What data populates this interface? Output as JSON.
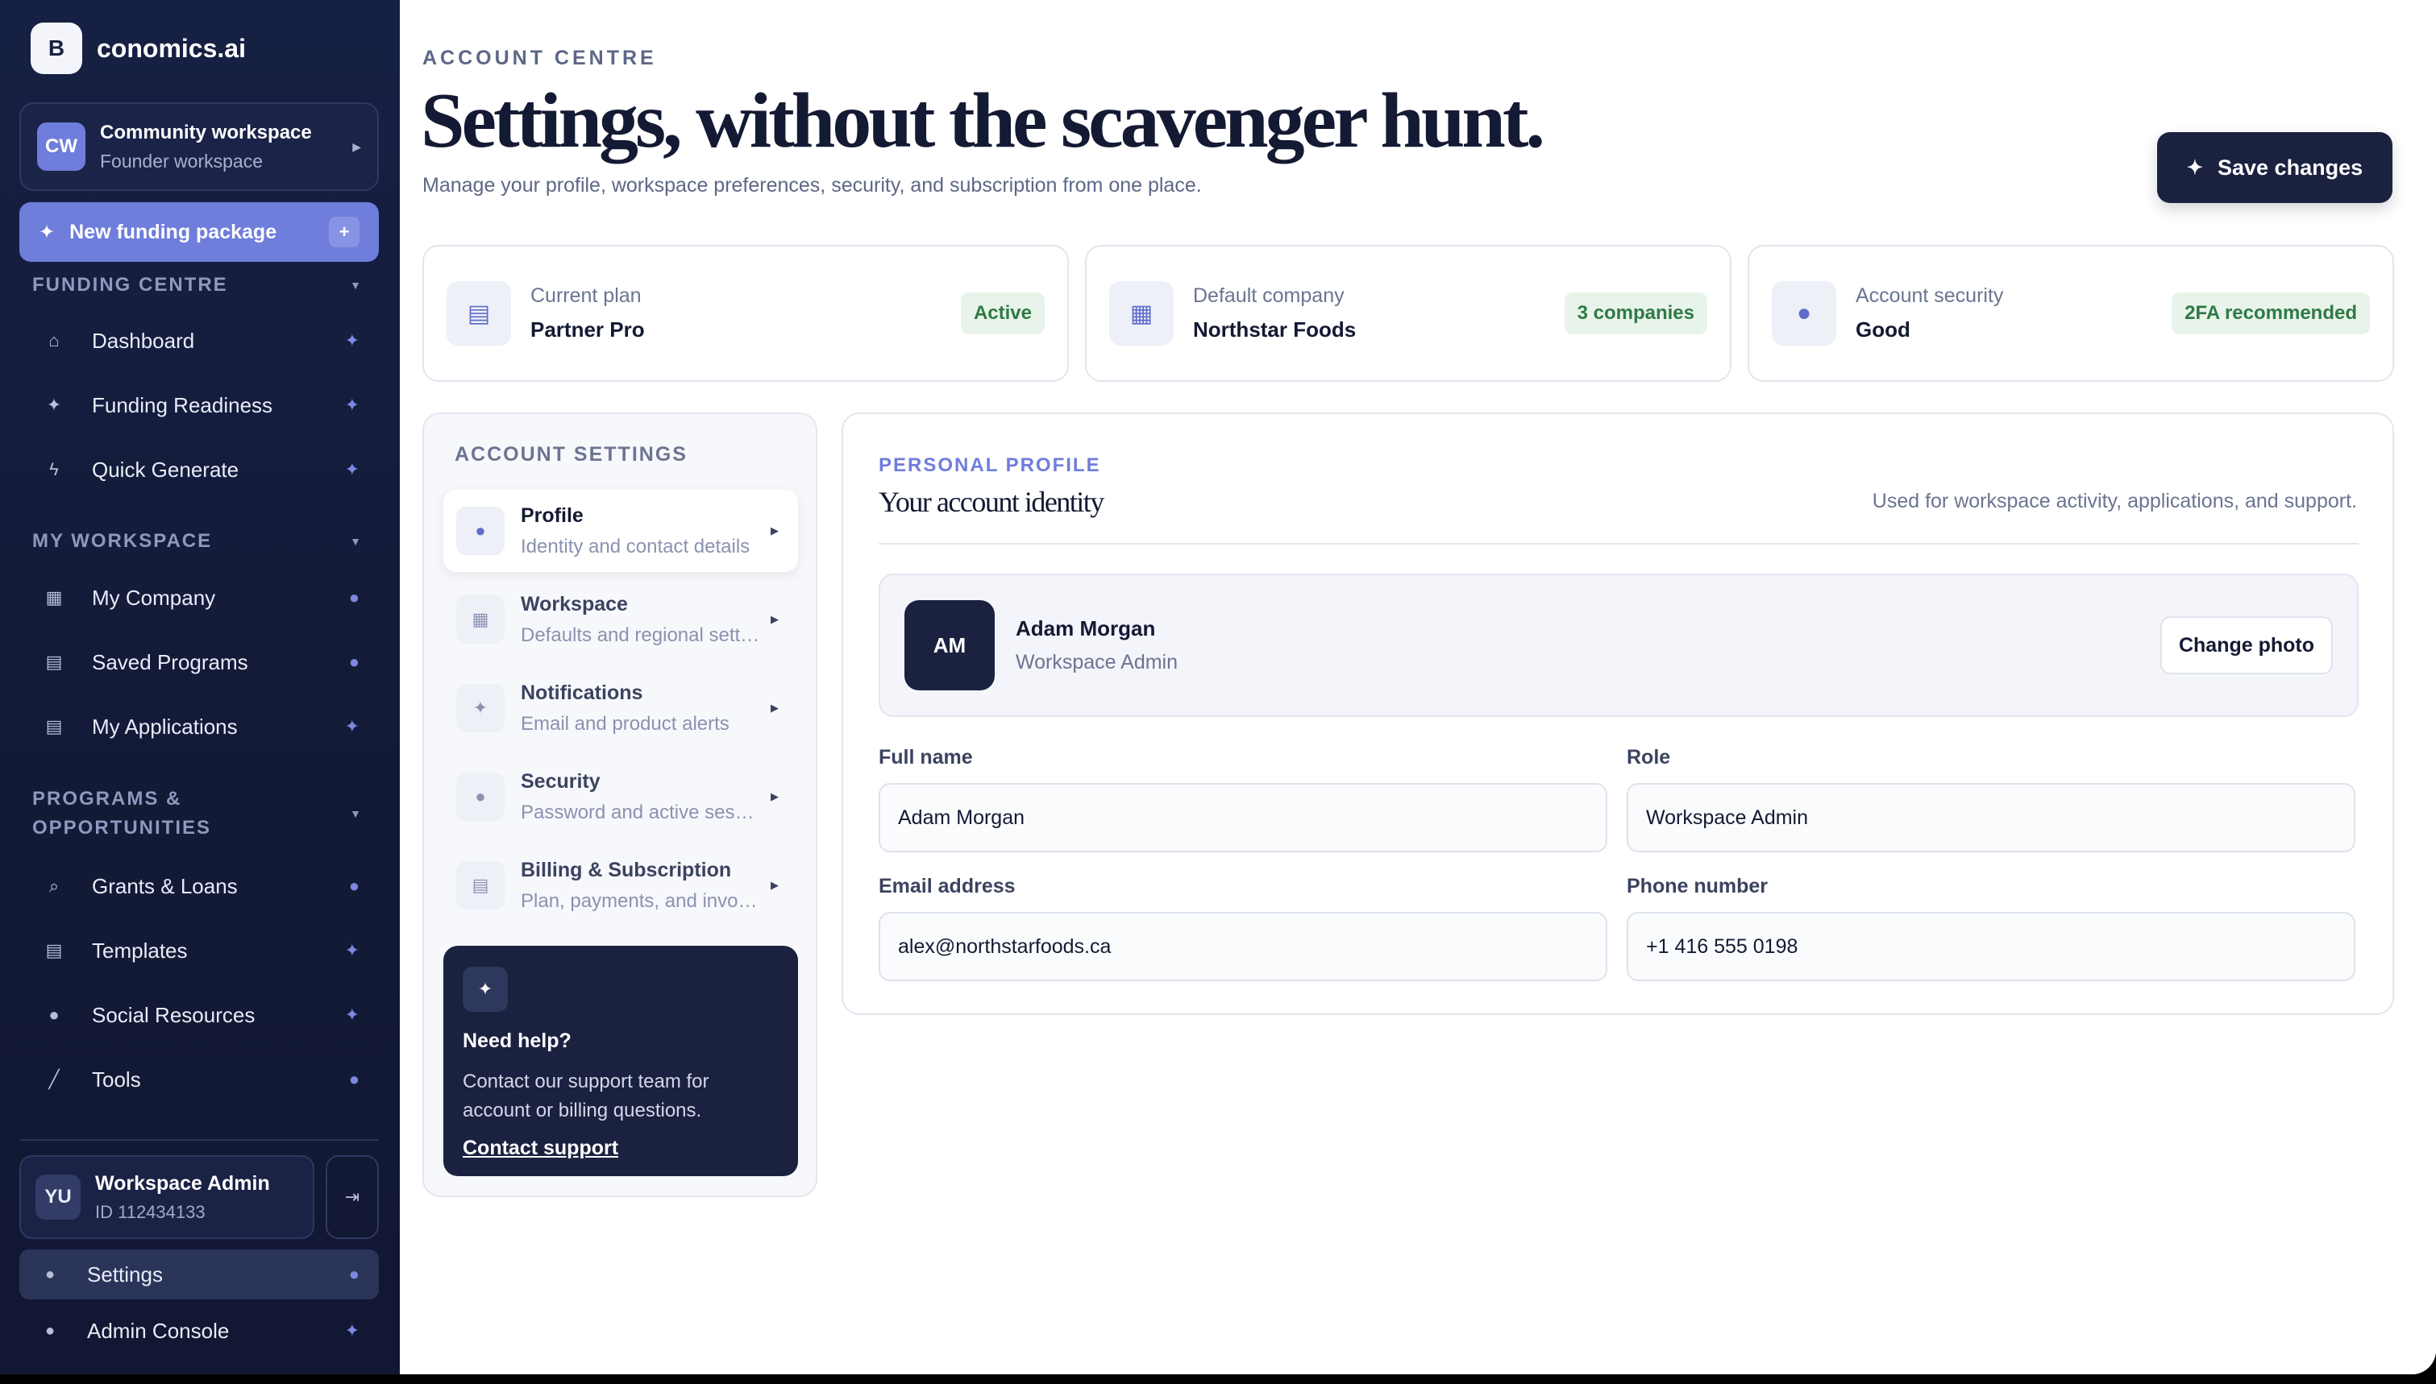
{
  "brand": {
    "logo_letter": "B",
    "name": "conomics.ai"
  },
  "workspace": {
    "initials": "CW",
    "title": "Community workspace",
    "subtitle": "Founder workspace"
  },
  "new_package": {
    "label": "New funding package",
    "plus": "+"
  },
  "sidebar": {
    "sections": [
      {
        "title": "FUNDING CENTRE",
        "items": [
          {
            "label": "Dashboard",
            "icon": "home-icon",
            "tail": "sparkle-icon"
          },
          {
            "label": "Funding Readiness",
            "icon": "sparkle-icon",
            "tail": "sparkle-icon"
          },
          {
            "label": "Quick Generate",
            "icon": "bolt-icon",
            "tail": "sparkle-icon"
          }
        ]
      },
      {
        "title": "MY WORKSPACE",
        "items": [
          {
            "label": "My Company",
            "icon": "grid-icon",
            "tail": "user-icon"
          },
          {
            "label": "Saved Programs",
            "icon": "document-icon",
            "tail": "user-icon"
          },
          {
            "label": "My Applications",
            "icon": "document-icon",
            "tail": "sparkle-icon"
          }
        ]
      },
      {
        "title_line1": "PROGRAMS &",
        "title_line2": "OPPORTUNITIES",
        "items": [
          {
            "label": "Grants & Loans",
            "icon": "search-icon",
            "tail": "user-icon"
          },
          {
            "label": "Templates",
            "icon": "document-icon",
            "tail": "sparkle-icon"
          },
          {
            "label": "Social Resources",
            "icon": "user-icon",
            "tail": "sparkle-icon"
          },
          {
            "label": "Tools",
            "icon": "wrench-icon",
            "tail": "user-icon"
          }
        ]
      }
    ],
    "user": {
      "initials": "YU",
      "name": "Workspace Admin",
      "id": "ID 112434133"
    },
    "bottom": [
      {
        "label": "Settings",
        "icon": "lock-icon",
        "tail": "user-icon",
        "active": true
      },
      {
        "label": "Admin Console",
        "icon": "lock-icon",
        "tail": "sparkle-icon",
        "active": false
      }
    ]
  },
  "header": {
    "eyebrow": "ACCOUNT CENTRE",
    "title": "Settings, without the scavenger hunt.",
    "subtitle": "Manage your profile, workspace preferences, security, and subscription from one place.",
    "save_label": "Save changes"
  },
  "stats": [
    {
      "label": "Current plan",
      "value": "Partner Pro",
      "badge": "Active",
      "icon": "document-icon"
    },
    {
      "label": "Default company",
      "value": "Northstar Foods",
      "badge": "3 companies",
      "icon": "grid-icon"
    },
    {
      "label": "Account security",
      "value": "Good",
      "badge": "2FA recommended",
      "icon": "lock-icon"
    }
  ],
  "account_settings": {
    "title": "ACCOUNT SETTINGS",
    "items": [
      {
        "title": "Profile",
        "desc": "Identity and contact details",
        "icon": "user-icon",
        "active": true
      },
      {
        "title": "Workspace",
        "desc": "Defaults and regional settings",
        "icon": "grid-icon",
        "active": false
      },
      {
        "title": "Notifications",
        "desc": "Email and product alerts",
        "icon": "sparkle-icon",
        "active": false
      },
      {
        "title": "Security",
        "desc": "Password and active sessions",
        "icon": "lock-icon",
        "active": false
      },
      {
        "title": "Billing & Subscription",
        "desc": "Plan, payments, and invoices",
        "icon": "document-icon",
        "active": false
      }
    ],
    "help": {
      "title": "Need help?",
      "body": "Contact our support team for account or billing questions.",
      "link": "Contact support"
    }
  },
  "profile": {
    "eyebrow": "PERSONAL PROFILE",
    "title": "Your account identity",
    "note": "Used for workspace activity, applications, and support.",
    "avatar_initials": "AM",
    "name": "Adam Morgan",
    "role": "Workspace Admin",
    "change_photo": "Change photo",
    "fields": {
      "full_name": {
        "label": "Full name",
        "value": "Adam Morgan"
      },
      "role": {
        "label": "Role",
        "value": "Workspace Admin"
      },
      "email": {
        "label": "Email address",
        "value": "alex@northstarfoods.ca"
      },
      "phone": {
        "label": "Phone number",
        "value": "+1 416 555 0198"
      }
    }
  }
}
